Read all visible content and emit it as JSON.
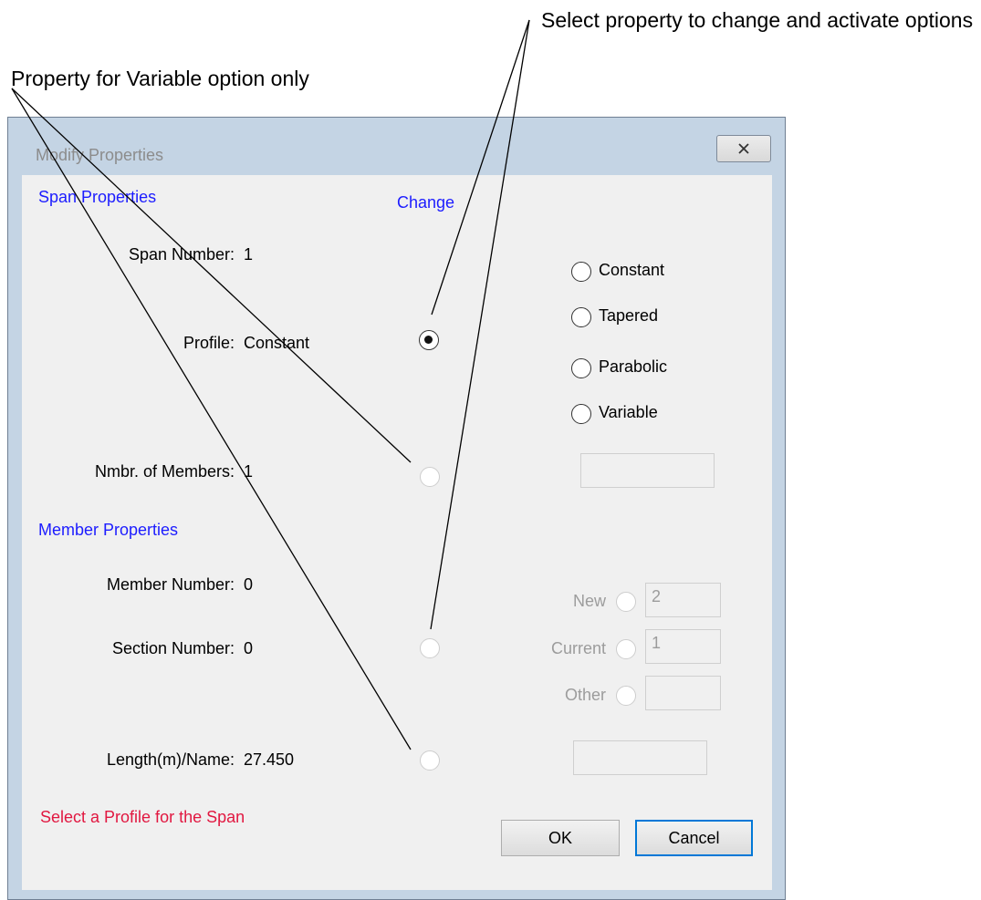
{
  "callouts": {
    "left": "Property for Variable option only",
    "right": "Select property to change and activate options"
  },
  "window": {
    "title": "Modify Properties",
    "close_icon": "close-icon"
  },
  "span": {
    "heading": "Span Properties",
    "change_heading": "Change",
    "span_number_label": "Span Number:",
    "span_number_value": "1",
    "profile_label": "Profile:",
    "profile_value": "Constant",
    "members_label": "Nmbr. of Members:",
    "members_value": "1",
    "profile_options": [
      "Constant",
      "Tapered",
      "Parabolic",
      "Variable"
    ]
  },
  "member": {
    "heading": "Member Properties",
    "member_number_label": "Member Number:",
    "member_number_value": "0",
    "section_number_label": "Section Number:",
    "section_number_value": "0",
    "length_label": "Length(m)/Name:",
    "length_value": "27.450",
    "section_options": [
      {
        "label": "New",
        "value": "2"
      },
      {
        "label": "Current",
        "value": "1"
      },
      {
        "label": "Other",
        "value": ""
      }
    ]
  },
  "status_message": "Select a Profile for the Span",
  "buttons": {
    "ok": "OK",
    "cancel": "Cancel"
  },
  "colors": {
    "heading_blue": "#1c1cff",
    "status_red": "#e11740",
    "default_button_border": "#0078d7"
  }
}
